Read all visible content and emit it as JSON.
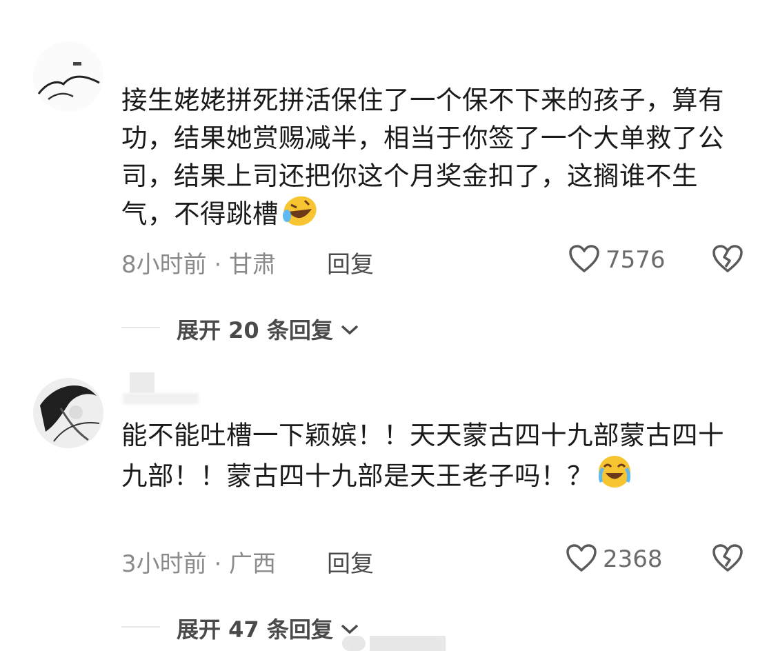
{
  "comments": [
    {
      "text": "接生姥姥拼死拼活保住了一个保不下来的孩子，算有功，结果她赏赐减半，相当于你签了一个大单救了公司，结果上司还把你这个月奖金扣了，这搁谁不生气，不得跳槽",
      "emoji": "rolling-laugh-emoji",
      "time_location": "8小时前 · 甘肃",
      "reply_label": "回复",
      "like_count": "7576",
      "expand_label": "展开 20 条回复"
    },
    {
      "text": "能不能吐槽一下颖嫔！！天天蒙古四十九部蒙古四十九部！！蒙古四十九部是天王老子吗！？",
      "emoji": "crying-laugh-emoji",
      "time_location": "3小时前 · 广西",
      "reply_label": "回复",
      "like_count": "2368",
      "expand_label": "展开 47 条回复"
    }
  ],
  "colors": {
    "text": "#1a1a1a",
    "meta": "#8a8a8a",
    "icon": "#5a5a5a",
    "emoji": "#f7c531"
  }
}
